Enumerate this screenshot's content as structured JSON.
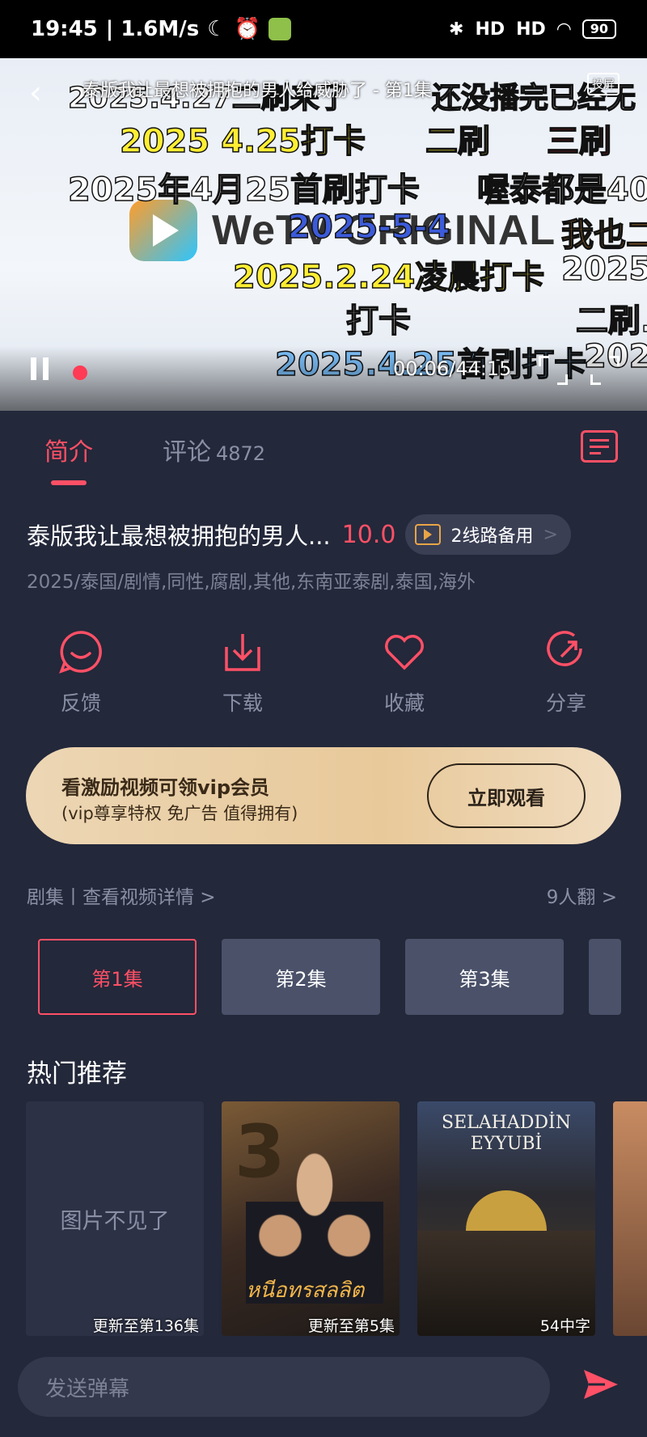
{
  "status_bar": {
    "time": "19:45",
    "speed": "| 1.6M/s",
    "battery": "90",
    "signal1": "HD",
    "signal2": "HD"
  },
  "player": {
    "title": "泰版我让最想被拥抱的男人给威胁了 - 第1集",
    "cast_label": "投屏",
    "brand": "WeTV ORIGINAL",
    "time": "00:06/44:15",
    "danmaku": [
      {
        "text": "2025.4.27二刷来了",
        "color": "#ffffff"
      },
      {
        "text": "还没播完已经无",
        "color": "#ffffff"
      },
      {
        "text": "2025 4.25打卡",
        "color": "#ffee33"
      },
      {
        "text": "二刷",
        "color": "#ffee33"
      },
      {
        "text": "三刷",
        "color": "#e8222e"
      },
      {
        "text": "2025年4月25首刷打卡",
        "color": "#ffffff"
      },
      {
        "text": "喔泰都是40",
        "color": "#ffffff"
      },
      {
        "text": "2025-5-4",
        "color": "#3c5bd9"
      },
      {
        "text": "我也二",
        "color": "#f2a23c"
      },
      {
        "text": "2025.2.24凌晨打卡",
        "color": "#ffee33"
      },
      {
        "text": "2025.",
        "color": "#ffffff"
      },
      {
        "text": "打卡",
        "color": "#ffffff"
      },
      {
        "text": "二刷.",
        "color": "#ffffff"
      },
      {
        "text": "2025.4.25首刷打卡",
        "color": "#7fc4ff"
      },
      {
        "text": "202",
        "color": "#ffffff"
      }
    ]
  },
  "tabs": [
    {
      "label": "简介",
      "count": ""
    },
    {
      "label": "评论",
      "count": "4872"
    }
  ],
  "show": {
    "title": "泰版我让最想被拥抱的男人...",
    "score": "10.0",
    "line_button": "2线路备用",
    "line_chevron": ">",
    "tags": "2025/泰国/剧情,同性,腐剧,其他,东南亚泰剧,泰国,海外"
  },
  "actions": [
    {
      "label": "反馈",
      "icon": "smile-feedback-icon"
    },
    {
      "label": "下载",
      "icon": "download-icon"
    },
    {
      "label": "收藏",
      "icon": "heart-icon"
    },
    {
      "label": "分享",
      "icon": "share-icon"
    }
  ],
  "vip_banner": {
    "title": "看激励视频可领vip会员",
    "subtitle": "(vip尊享特权 免广告 值得拥有)",
    "button": "立即观看"
  },
  "episodes": {
    "header_left": "剧集丨查看视频详情 >",
    "header_right": "9人翻 >",
    "items": [
      "第1集",
      "第2集",
      "第3集"
    ]
  },
  "recommend": {
    "title": "热门推荐",
    "items": [
      {
        "missing_text": "图片不见了",
        "caption": "更新至第136集"
      },
      {
        "caption": "更新至第5集",
        "poster_text": "หนีอทรสลลิต"
      },
      {
        "caption": "54中字",
        "poster_text": "SELAHADDİN EYYUBİ"
      }
    ]
  },
  "danmaku_input": {
    "placeholder": "发送弹幕"
  },
  "colors": {
    "accent": "#ff5066",
    "background": "#23283a",
    "vip_gold": "#e8c99a"
  }
}
